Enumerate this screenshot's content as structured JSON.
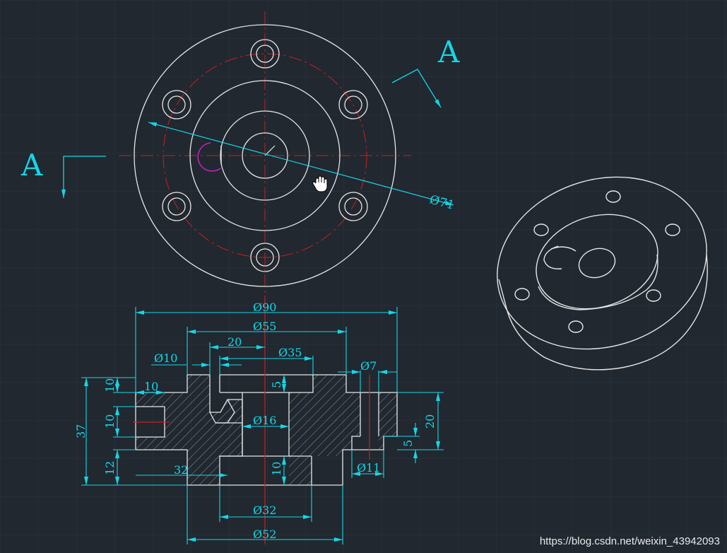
{
  "colors": {
    "background": "#212830",
    "grid": "#2f3944",
    "geometry": "#e6e6e6",
    "centerline": "#c8211e",
    "dimension": "#14d7e6",
    "keyway_arc": "#d020c8"
  },
  "section_label_top": "A",
  "section_label_left": "A",
  "top_view": {
    "radius_dimension": "Ø71"
  },
  "section_view": {
    "dim_phi90": "Ø90",
    "dim_phi55": "Ø55",
    "dim_20": "20",
    "dim_phi35": "Ø35",
    "dim_phi10": "Ø10",
    "dim_phi7": "Ø7",
    "dim_10_top": "10",
    "dim_10_horiz": "10",
    "dim_10_mid": "10",
    "dim_37": "37",
    "dim_5_top": "5",
    "dim_phi16": "Ø16",
    "dim_20_right": "20",
    "dim_5_right": "5",
    "dim_12": "12",
    "dim_32": "32",
    "dim_10_bottom": "10",
    "dim_phi11": "Ø11",
    "dim_phi32": "Ø32",
    "dim_phi52": "Ø52"
  },
  "cursor_icon": "hand-pan-icon",
  "watermark": "https://blog.csdn.net/weixin_43942093"
}
